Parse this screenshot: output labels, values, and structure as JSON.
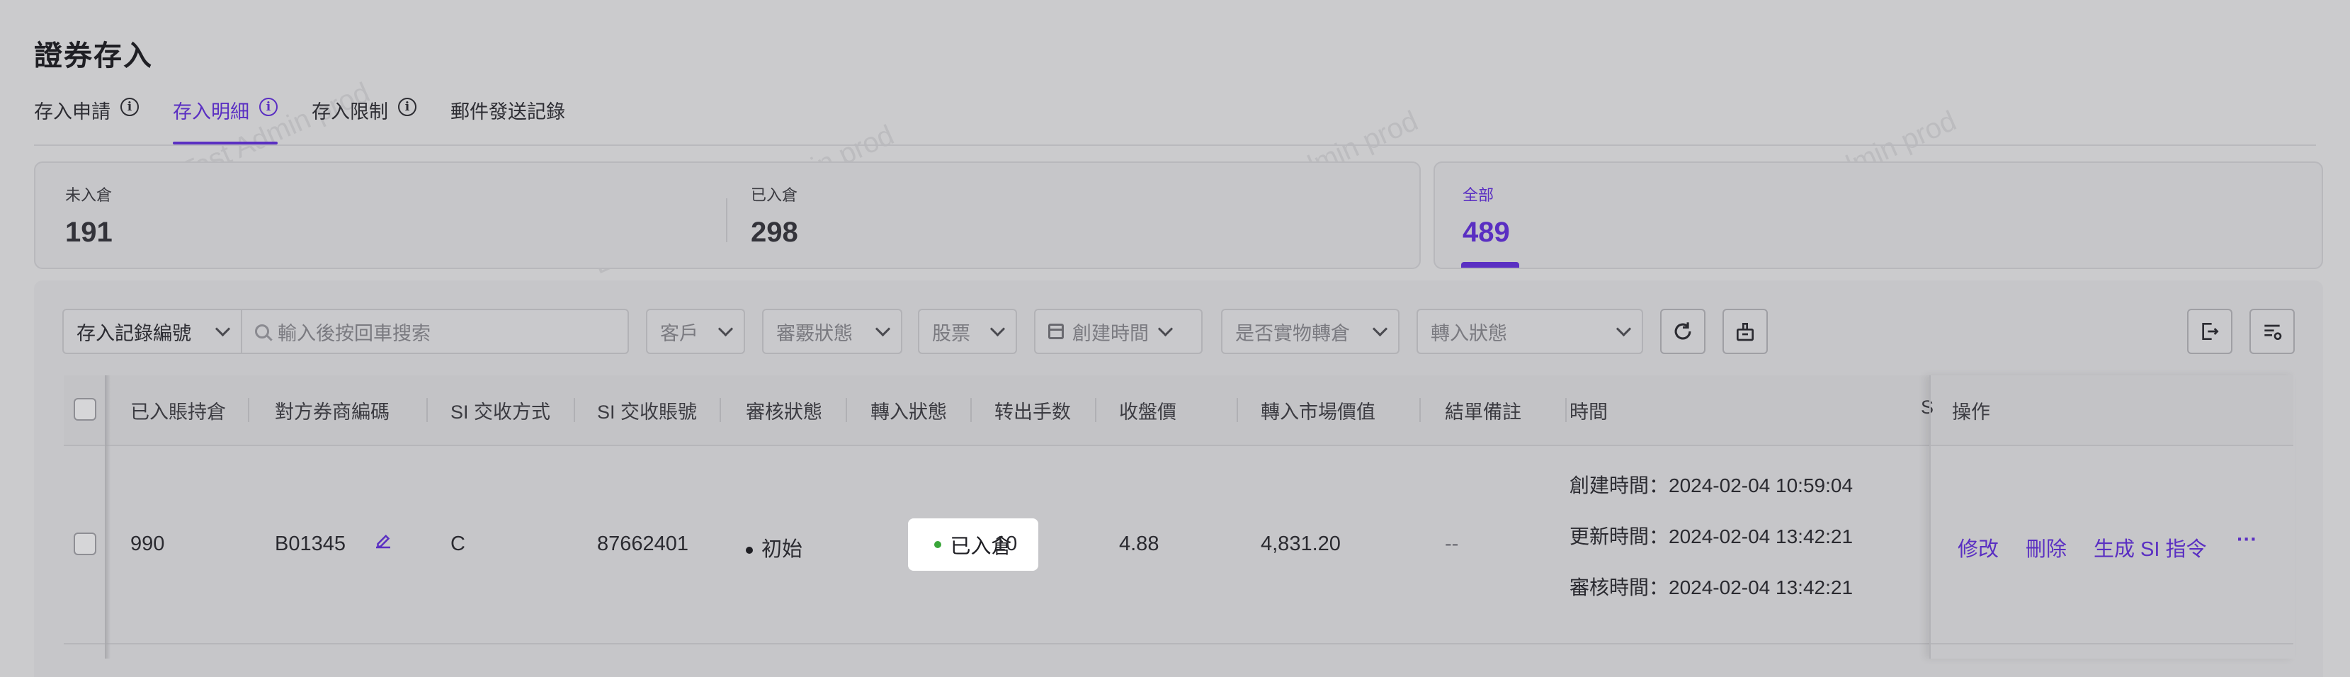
{
  "page": {
    "title": "證券存入"
  },
  "tabs": [
    {
      "label": "存入申請",
      "has_info": true,
      "active": false
    },
    {
      "label": "存入明細",
      "has_info": true,
      "active": true
    },
    {
      "label": "存入限制",
      "has_info": true,
      "active": false
    },
    {
      "label": "郵件發送記錄",
      "has_info": false,
      "active": false
    }
  ],
  "stats": [
    {
      "label": "未入倉",
      "value": "191"
    },
    {
      "label": "已入倉",
      "value": "298"
    },
    {
      "label": "全部",
      "value": "489",
      "active": true
    }
  ],
  "filters": {
    "record_select": "存入記錄編號",
    "search_placeholder": "輸入後按回車搜索",
    "customer": "客戶",
    "review_status": "審覈狀態",
    "stock": "股票",
    "created_time": "創建時間",
    "physical_transfer": "是否實物轉倉",
    "transfer_status": "轉入狀態"
  },
  "table": {
    "columns": [
      "已入賬持倉",
      "對方券商編碼",
      "SI 交收方式",
      "SI 交收賬號",
      "審核狀態",
      "轉入狀態",
      "转出手数",
      "收盤價",
      "轉入市場價值",
      "結單備註",
      "時間",
      "S",
      "操作"
    ],
    "rows": [
      {
        "credited": "990",
        "broker_code": "B01345",
        "si_method": "C",
        "si_account": "87662401",
        "review_status": "初始",
        "transfer_status": "已入倉",
        "lots": "10",
        "close_price": "4.88",
        "market_value": "4,831.20",
        "remark": "--",
        "created_label": "創建時間：",
        "created_value": "2024-02-04 10:59:04",
        "updated_label": "更新時間：",
        "updated_value": "2024-02-04 13:42:21",
        "reviewed_label": "審核時間：",
        "reviewed_value": "2024-02-04 13:42:21",
        "actions": [
          "修改",
          "刪除",
          "生成 SI 指令",
          "···"
        ]
      }
    ]
  },
  "watermark": "LongPort Test Admin prod",
  "colors": {
    "accent": "#5a2fc2",
    "success_dot": "#3aa63a"
  }
}
